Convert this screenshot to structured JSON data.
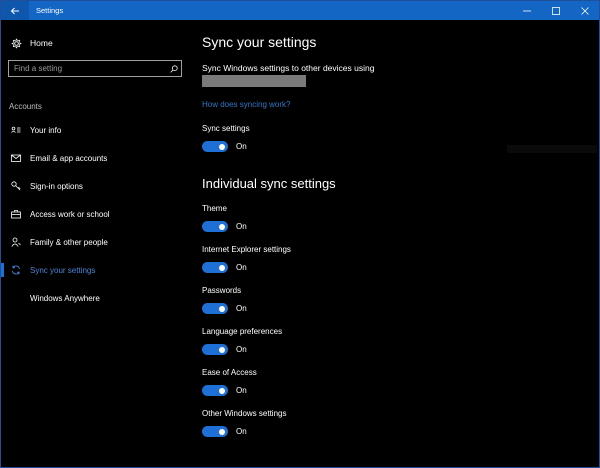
{
  "window": {
    "title": "Settings",
    "accent": "#1366c4"
  },
  "sidebar": {
    "home_label": "Home",
    "search_placeholder": "Find a setting",
    "section_label": "Accounts",
    "items": [
      {
        "label": "Your info",
        "icon": "contact-card-icon"
      },
      {
        "label": "Email & app accounts",
        "icon": "mail-icon"
      },
      {
        "label": "Sign-in options",
        "icon": "key-icon"
      },
      {
        "label": "Access work or school",
        "icon": "briefcase-icon"
      },
      {
        "label": "Family & other people",
        "icon": "person-icon"
      },
      {
        "label": "Sync your settings",
        "icon": "sync-icon",
        "active": true
      },
      {
        "label": "Windows Anywhere",
        "icon": ""
      }
    ]
  },
  "main": {
    "title": "Sync your settings",
    "description": "Sync Windows settings to other devices using",
    "link": "How does syncing work?",
    "sync_settings": {
      "label": "Sync settings",
      "state": "On"
    },
    "individual_heading": "Individual sync settings",
    "individual": [
      {
        "label": "Theme",
        "state": "On"
      },
      {
        "label": "Internet Explorer settings",
        "state": "On"
      },
      {
        "label": "Passwords",
        "state": "On"
      },
      {
        "label": "Language preferences",
        "state": "On"
      },
      {
        "label": "Ease of Access",
        "state": "On"
      },
      {
        "label": "Other Windows settings",
        "state": "On"
      }
    ]
  }
}
